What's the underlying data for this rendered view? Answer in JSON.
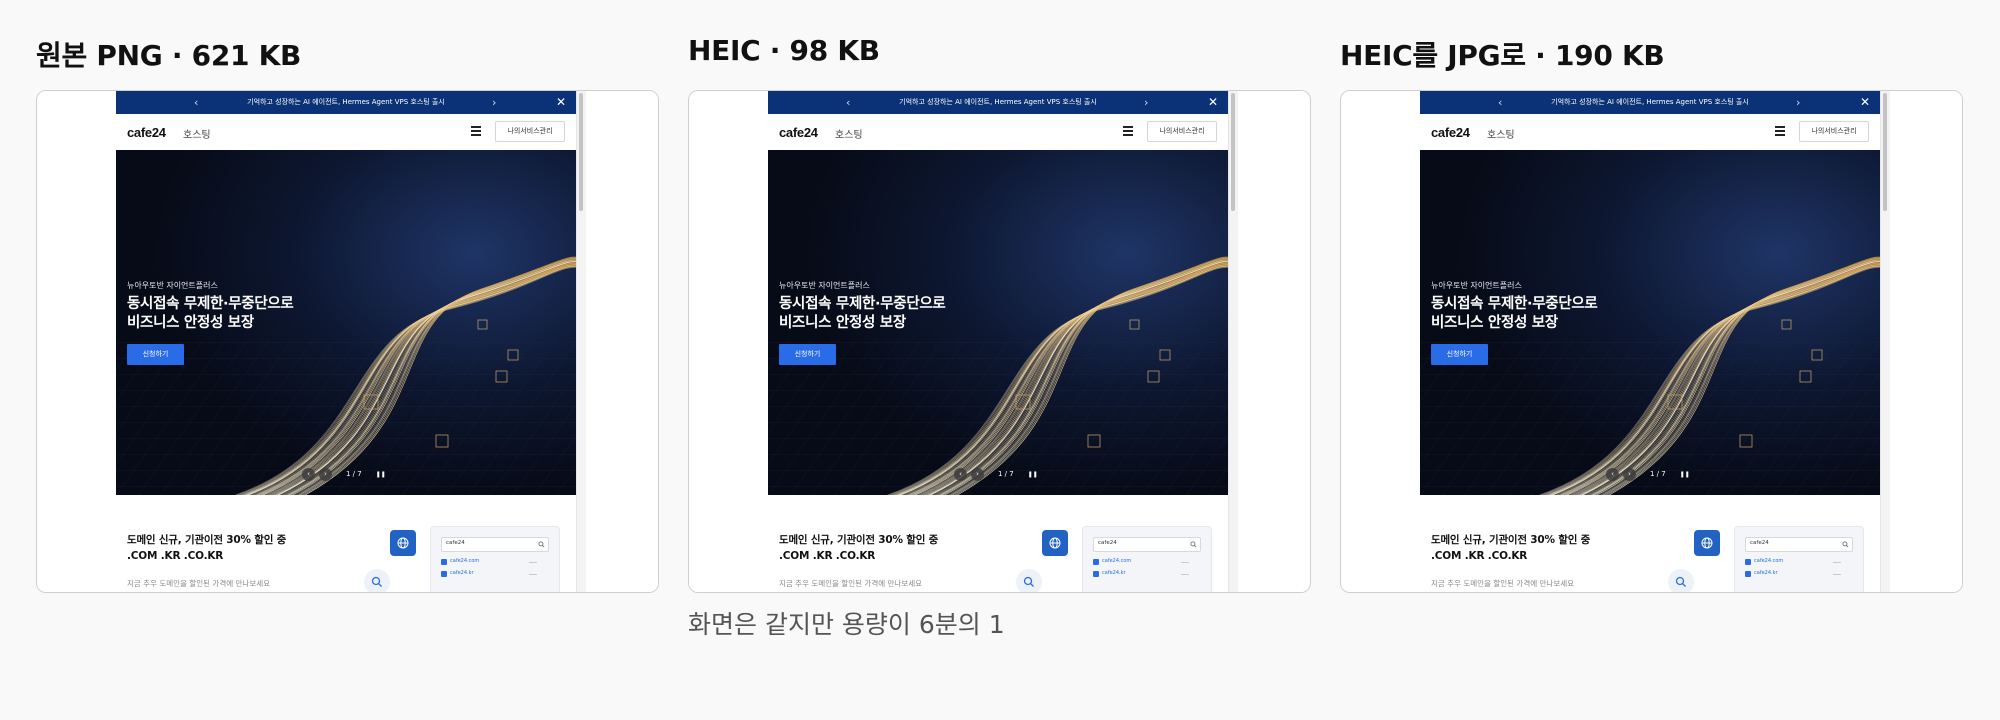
{
  "panels": [
    {
      "title": "원본 PNG · 621 KB"
    },
    {
      "title": "HEIC · 98 KB"
    },
    {
      "title": "HEIC를 JPG로 · 190 KB"
    }
  ],
  "site": {
    "topbar": {
      "text": "기억하고 성장하는 AI 에이전트, Hermes Agent VPS 호스팅 출시",
      "prev_icon": "chevron-left-icon",
      "next_icon": "chevron-right-icon",
      "close_icon": "close-icon"
    },
    "header": {
      "logo": "cafe24",
      "logo_sub": "호스팅",
      "menu_icon": "hamburger-menu-icon",
      "my_service_label": "나의서비스관리"
    },
    "hero": {
      "eyebrow": "뉴아우토반 자이언트플러스",
      "title_line1": "동시접속 무제한·무중단으로",
      "title_line2": "비즈니스 안정성 보장",
      "cta_label": "신청하기",
      "slide_counter": "1 / 7",
      "pause_icon": "pause-icon",
      "prev_icon": "chevron-left-icon",
      "next_icon": "chevron-right-icon"
    },
    "promo": {
      "title_line1": "도메인 신규, 기관이전 30% 할인 중",
      "title_line2": ".COM .KR .CO.KR",
      "description": "지금 추우 도메인을 할인된 가격에 만나보세요",
      "globe_icon": "globe-icon",
      "search_icon": "search-icon",
      "mock_search_value": "cafe24",
      "mock_results": [
        "cafe24.com",
        "cafe24.kr"
      ]
    }
  },
  "caption": "화면은 같지만 용량이 6분의 1",
  "colors": {
    "topbar": "#0b3276",
    "cta": "#2a6be8",
    "globe_badge": "#2162c2",
    "hero_base": "#0a1226",
    "light_trail": "#f3c777"
  }
}
